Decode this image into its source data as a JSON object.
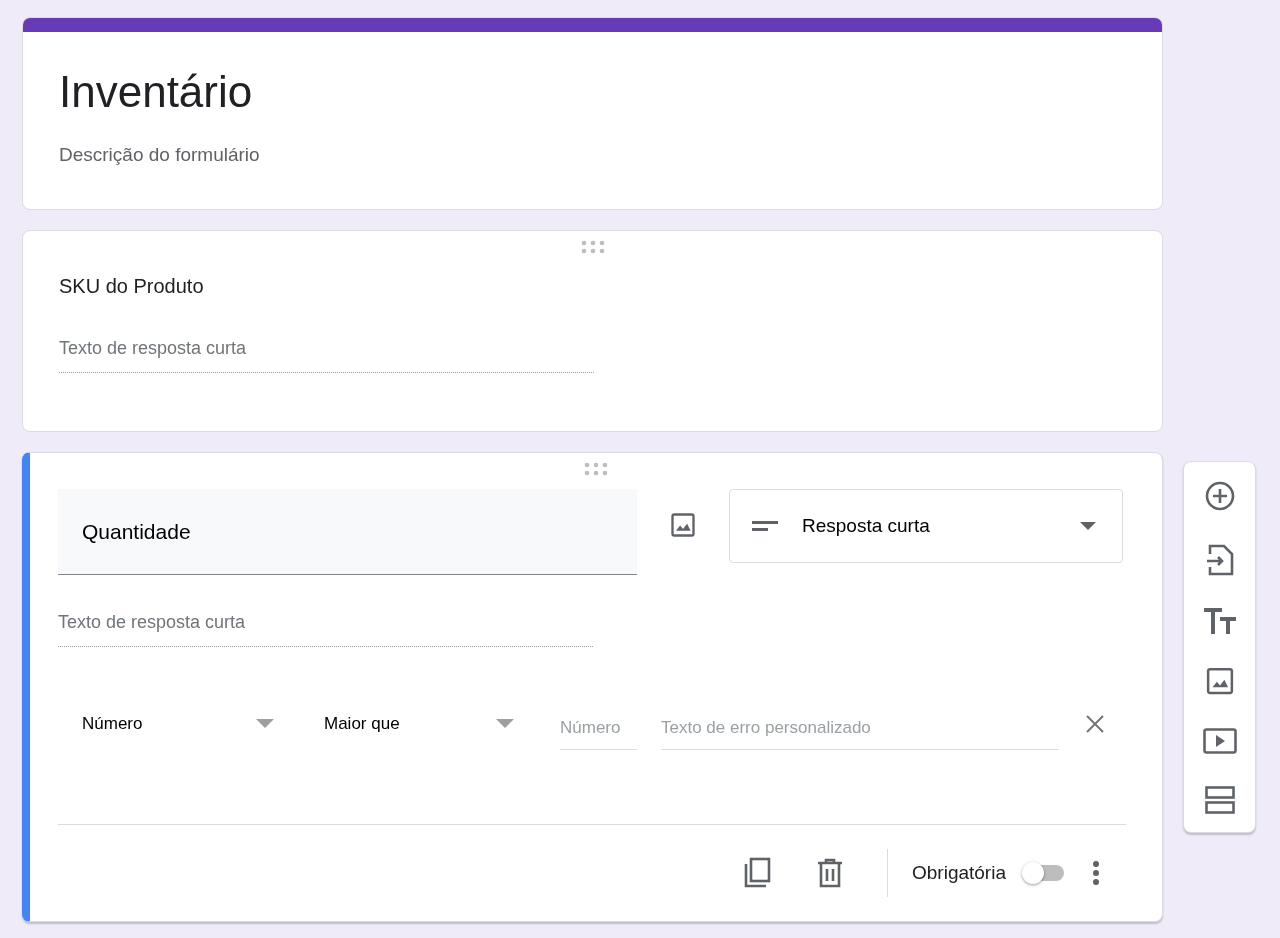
{
  "form": {
    "title": "Inventário",
    "description_placeholder": "Descrição do formulário"
  },
  "questions": [
    {
      "kind": "view",
      "selected": false,
      "title": "SKU do Produto",
      "answer_placeholder": "Texto de resposta curta"
    },
    {
      "kind": "edit",
      "selected": true,
      "title": "Quantidade",
      "answer_placeholder": "Texto de resposta curta",
      "type_label": "Resposta curta",
      "validation": {
        "type": "Número",
        "condition": "Maior que",
        "number_placeholder": "Número",
        "error_placeholder": "Texto de erro personalizado"
      },
      "required_label": "Obrigatória",
      "required": false
    }
  ]
}
